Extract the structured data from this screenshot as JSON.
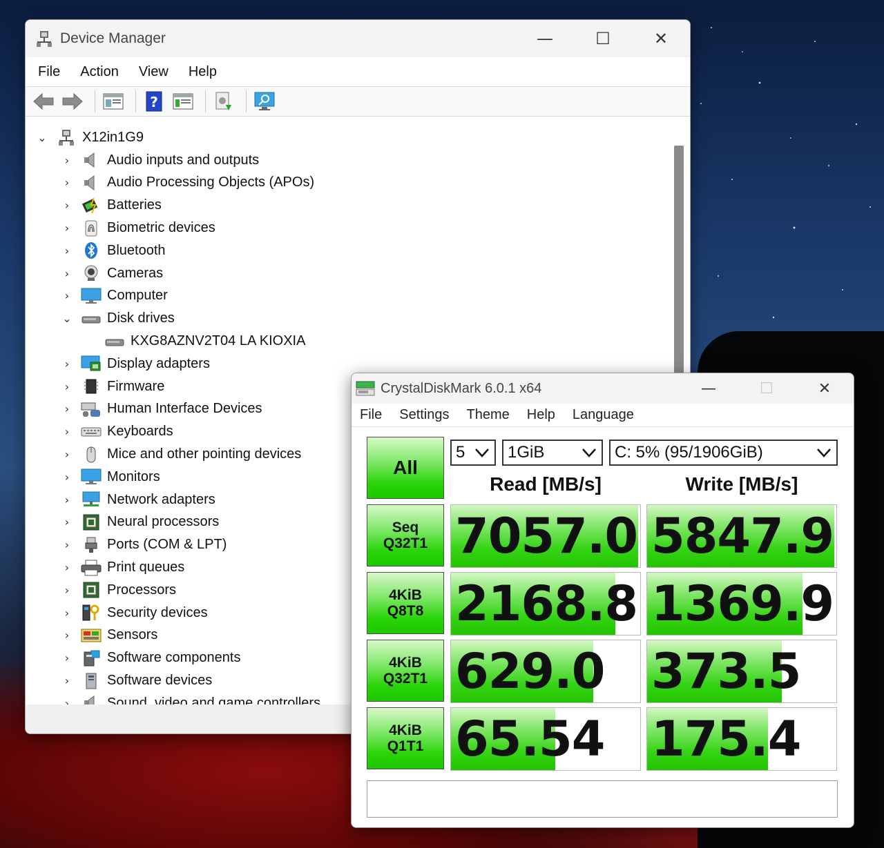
{
  "device_manager": {
    "title": "Device Manager",
    "menu": [
      "File",
      "Action",
      "View",
      "Help"
    ],
    "root": "X12in1G9",
    "items": [
      {
        "label": "Audio inputs and outputs",
        "icon": "speaker-icon",
        "expanded": false
      },
      {
        "label": "Audio Processing Objects (APOs)",
        "icon": "speaker-icon",
        "expanded": false
      },
      {
        "label": "Batteries",
        "icon": "battery-icon",
        "expanded": false
      },
      {
        "label": "Biometric devices",
        "icon": "fingerprint-icon",
        "expanded": false
      },
      {
        "label": "Bluetooth",
        "icon": "bluetooth-icon",
        "expanded": false
      },
      {
        "label": "Cameras",
        "icon": "camera-icon",
        "expanded": false
      },
      {
        "label": "Computer",
        "icon": "monitor-icon",
        "expanded": false
      },
      {
        "label": "Disk drives",
        "icon": "disk-drive-icon",
        "expanded": true
      },
      {
        "label": "KXG8AZNV2T04 LA KIOXIA",
        "icon": "disk-drive-icon",
        "child": true
      },
      {
        "label": "Display adapters",
        "icon": "display-adapter-icon",
        "expanded": false
      },
      {
        "label": "Firmware",
        "icon": "firmware-icon",
        "expanded": false
      },
      {
        "label": "Human Interface Devices",
        "icon": "hid-icon",
        "expanded": false
      },
      {
        "label": "Keyboards",
        "icon": "keyboard-icon",
        "expanded": false
      },
      {
        "label": "Mice and other pointing devices",
        "icon": "mouse-icon",
        "expanded": false
      },
      {
        "label": "Monitors",
        "icon": "monitor-icon",
        "expanded": false
      },
      {
        "label": "Network adapters",
        "icon": "network-icon",
        "expanded": false
      },
      {
        "label": "Neural processors",
        "icon": "chip-icon",
        "expanded": false
      },
      {
        "label": "Ports (COM & LPT)",
        "icon": "port-icon",
        "expanded": false
      },
      {
        "label": "Print queues",
        "icon": "printer-icon",
        "expanded": false
      },
      {
        "label": "Processors",
        "icon": "chip-icon",
        "expanded": false
      },
      {
        "label": "Security devices",
        "icon": "security-key-icon",
        "expanded": false
      },
      {
        "label": "Sensors",
        "icon": "sensor-icon",
        "expanded": false
      },
      {
        "label": "Software components",
        "icon": "software-component-icon",
        "expanded": false
      },
      {
        "label": "Software devices",
        "icon": "software-device-icon",
        "expanded": false
      },
      {
        "label": "Sound, video and game controllers",
        "icon": "speaker-icon",
        "expanded": false
      }
    ]
  },
  "crystaldiskmark": {
    "title": "CrystalDiskMark 6.0.1 x64",
    "menu": [
      "File",
      "Settings",
      "Theme",
      "Help",
      "Language"
    ],
    "all_button": "All",
    "count": "5",
    "size": "1GiB",
    "drive": "C: 5% (95/1906GiB)",
    "read_header": "Read [MB/s]",
    "write_header": "Write [MB/s]",
    "tests": [
      {
        "line1": "Seq",
        "line2": "Q32T1",
        "read": "7057.0",
        "write": "5847.9",
        "read_fill": 0.99,
        "write_fill": 0.99
      },
      {
        "line1": "4KiB",
        "line2": "Q8T8",
        "read": "2168.8",
        "write": "1369.9",
        "read_fill": 0.87,
        "write_fill": 0.82
      },
      {
        "line1": "4KiB",
        "line2": "Q32T1",
        "read": "629.0",
        "write": "373.5",
        "read_fill": 0.75,
        "write_fill": 0.71
      },
      {
        "line1": "4KiB",
        "line2": "Q1T1",
        "read": "65.54",
        "write": "175.4",
        "read_fill": 0.55,
        "write_fill": 0.64
      }
    ],
    "comment": ""
  },
  "colors": {
    "accent_green": "#22c400",
    "window_bg": "#ffffff"
  }
}
